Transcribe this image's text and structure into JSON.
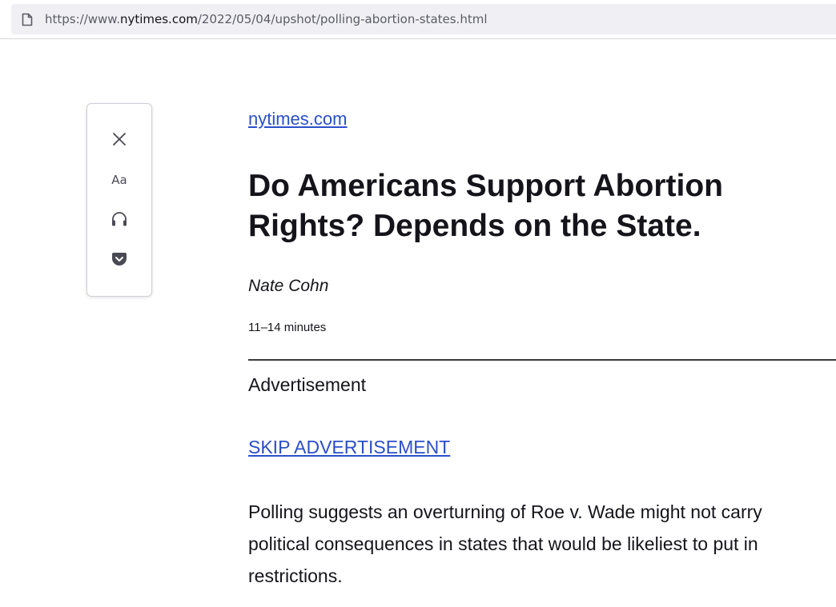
{
  "browser": {
    "url_prefix": "https://www.",
    "url_domain": "nytimes.com",
    "url_path": "/2022/05/04/upshot/polling-abortion-states.html",
    "page_icon": "page-icon"
  },
  "reader_toolbar": {
    "close_icon": "close-icon",
    "type_controls_label": "Aa",
    "listen_icon": "headphones-icon",
    "pocket_icon": "pocket-icon"
  },
  "article": {
    "site_link": "nytimes.com",
    "headline": "Do Americans Support Abortion Rights? Depends on the State.",
    "byline": "Nate Cohn",
    "reading_time": "11–14 minutes",
    "ad_label": "Advertisement",
    "skip_ad_link": "SKIP ADVERTISEMENT",
    "summary": "Polling suggests an overturning of Roe v. Wade might not carry political consequences in states that would be likeliest to put in restrictions."
  },
  "colors": {
    "link": "#2a4fc8",
    "text": "#15141a",
    "urlbar_bg": "#f0f0f4"
  }
}
